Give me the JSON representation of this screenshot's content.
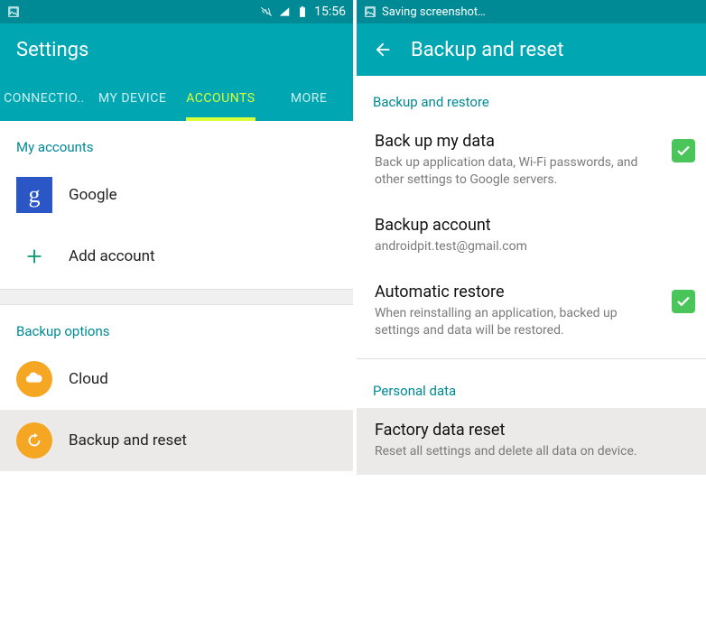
{
  "left": {
    "statusbar": {
      "time": "15:56"
    },
    "header": {
      "title": "Settings"
    },
    "tabs": [
      {
        "label": "CONNECTIO..",
        "active": false
      },
      {
        "label": "MY DEVICE",
        "active": false
      },
      {
        "label": "ACCOUNTS",
        "active": true
      },
      {
        "label": "MORE",
        "active": false
      }
    ],
    "accounts_section": "My accounts",
    "accounts": {
      "google": "Google",
      "add": "Add account"
    },
    "backup_section": "Backup options",
    "backup": {
      "cloud": "Cloud",
      "reset": "Backup and reset"
    }
  },
  "right": {
    "statusbar": {
      "text": "Saving screenshot…"
    },
    "header": {
      "title": "Backup and reset"
    },
    "section_backup": "Backup and restore",
    "backup_my_data": {
      "title": "Back up my data",
      "sub": "Back up application data, Wi-Fi passwords, and other settings to Google servers.",
      "checked": true
    },
    "backup_account": {
      "title": "Backup account",
      "sub": "androidpit.test@gmail.com"
    },
    "auto_restore": {
      "title": "Automatic restore",
      "sub": "When reinstalling an application, backed up settings and data will be restored.",
      "checked": true
    },
    "section_personal": "Personal data",
    "factory_reset": {
      "title": "Factory data reset",
      "sub": "Reset all settings and delete all data on device."
    }
  }
}
